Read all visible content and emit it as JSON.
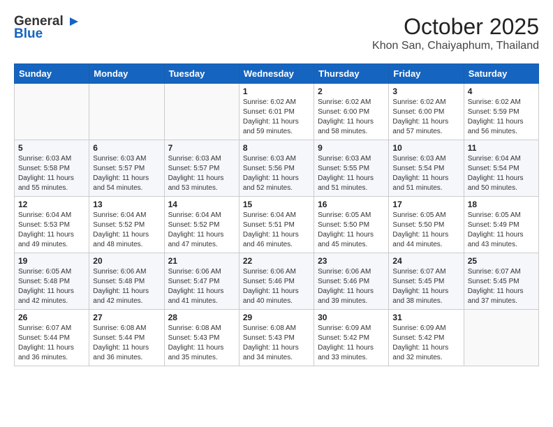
{
  "header": {
    "logo_general": "General",
    "logo_blue": "Blue",
    "title": "October 2025",
    "subtitle": "Khon San, Chaiyaphum, Thailand"
  },
  "days_of_week": [
    "Sunday",
    "Monday",
    "Tuesday",
    "Wednesday",
    "Thursday",
    "Friday",
    "Saturday"
  ],
  "weeks": [
    [
      {
        "day": "",
        "sunrise": "",
        "sunset": "",
        "daylight": ""
      },
      {
        "day": "",
        "sunrise": "",
        "sunset": "",
        "daylight": ""
      },
      {
        "day": "",
        "sunrise": "",
        "sunset": "",
        "daylight": ""
      },
      {
        "day": "1",
        "sunrise": "Sunrise: 6:02 AM",
        "sunset": "Sunset: 6:01 PM",
        "daylight": "Daylight: 11 hours and 59 minutes."
      },
      {
        "day": "2",
        "sunrise": "Sunrise: 6:02 AM",
        "sunset": "Sunset: 6:00 PM",
        "daylight": "Daylight: 11 hours and 58 minutes."
      },
      {
        "day": "3",
        "sunrise": "Sunrise: 6:02 AM",
        "sunset": "Sunset: 6:00 PM",
        "daylight": "Daylight: 11 hours and 57 minutes."
      },
      {
        "day": "4",
        "sunrise": "Sunrise: 6:02 AM",
        "sunset": "Sunset: 5:59 PM",
        "daylight": "Daylight: 11 hours and 56 minutes."
      }
    ],
    [
      {
        "day": "5",
        "sunrise": "Sunrise: 6:03 AM",
        "sunset": "Sunset: 5:58 PM",
        "daylight": "Daylight: 11 hours and 55 minutes."
      },
      {
        "day": "6",
        "sunrise": "Sunrise: 6:03 AM",
        "sunset": "Sunset: 5:57 PM",
        "daylight": "Daylight: 11 hours and 54 minutes."
      },
      {
        "day": "7",
        "sunrise": "Sunrise: 6:03 AM",
        "sunset": "Sunset: 5:57 PM",
        "daylight": "Daylight: 11 hours and 53 minutes."
      },
      {
        "day": "8",
        "sunrise": "Sunrise: 6:03 AM",
        "sunset": "Sunset: 5:56 PM",
        "daylight": "Daylight: 11 hours and 52 minutes."
      },
      {
        "day": "9",
        "sunrise": "Sunrise: 6:03 AM",
        "sunset": "Sunset: 5:55 PM",
        "daylight": "Daylight: 11 hours and 51 minutes."
      },
      {
        "day": "10",
        "sunrise": "Sunrise: 6:03 AM",
        "sunset": "Sunset: 5:54 PM",
        "daylight": "Daylight: 11 hours and 51 minutes."
      },
      {
        "day": "11",
        "sunrise": "Sunrise: 6:04 AM",
        "sunset": "Sunset: 5:54 PM",
        "daylight": "Daylight: 11 hours and 50 minutes."
      }
    ],
    [
      {
        "day": "12",
        "sunrise": "Sunrise: 6:04 AM",
        "sunset": "Sunset: 5:53 PM",
        "daylight": "Daylight: 11 hours and 49 minutes."
      },
      {
        "day": "13",
        "sunrise": "Sunrise: 6:04 AM",
        "sunset": "Sunset: 5:52 PM",
        "daylight": "Daylight: 11 hours and 48 minutes."
      },
      {
        "day": "14",
        "sunrise": "Sunrise: 6:04 AM",
        "sunset": "Sunset: 5:52 PM",
        "daylight": "Daylight: 11 hours and 47 minutes."
      },
      {
        "day": "15",
        "sunrise": "Sunrise: 6:04 AM",
        "sunset": "Sunset: 5:51 PM",
        "daylight": "Daylight: 11 hours and 46 minutes."
      },
      {
        "day": "16",
        "sunrise": "Sunrise: 6:05 AM",
        "sunset": "Sunset: 5:50 PM",
        "daylight": "Daylight: 11 hours and 45 minutes."
      },
      {
        "day": "17",
        "sunrise": "Sunrise: 6:05 AM",
        "sunset": "Sunset: 5:50 PM",
        "daylight": "Daylight: 11 hours and 44 minutes."
      },
      {
        "day": "18",
        "sunrise": "Sunrise: 6:05 AM",
        "sunset": "Sunset: 5:49 PM",
        "daylight": "Daylight: 11 hours and 43 minutes."
      }
    ],
    [
      {
        "day": "19",
        "sunrise": "Sunrise: 6:05 AM",
        "sunset": "Sunset: 5:48 PM",
        "daylight": "Daylight: 11 hours and 42 minutes."
      },
      {
        "day": "20",
        "sunrise": "Sunrise: 6:06 AM",
        "sunset": "Sunset: 5:48 PM",
        "daylight": "Daylight: 11 hours and 42 minutes."
      },
      {
        "day": "21",
        "sunrise": "Sunrise: 6:06 AM",
        "sunset": "Sunset: 5:47 PM",
        "daylight": "Daylight: 11 hours and 41 minutes."
      },
      {
        "day": "22",
        "sunrise": "Sunrise: 6:06 AM",
        "sunset": "Sunset: 5:46 PM",
        "daylight": "Daylight: 11 hours and 40 minutes."
      },
      {
        "day": "23",
        "sunrise": "Sunrise: 6:06 AM",
        "sunset": "Sunset: 5:46 PM",
        "daylight": "Daylight: 11 hours and 39 minutes."
      },
      {
        "day": "24",
        "sunrise": "Sunrise: 6:07 AM",
        "sunset": "Sunset: 5:45 PM",
        "daylight": "Daylight: 11 hours and 38 minutes."
      },
      {
        "day": "25",
        "sunrise": "Sunrise: 6:07 AM",
        "sunset": "Sunset: 5:45 PM",
        "daylight": "Daylight: 11 hours and 37 minutes."
      }
    ],
    [
      {
        "day": "26",
        "sunrise": "Sunrise: 6:07 AM",
        "sunset": "Sunset: 5:44 PM",
        "daylight": "Daylight: 11 hours and 36 minutes."
      },
      {
        "day": "27",
        "sunrise": "Sunrise: 6:08 AM",
        "sunset": "Sunset: 5:44 PM",
        "daylight": "Daylight: 11 hours and 36 minutes."
      },
      {
        "day": "28",
        "sunrise": "Sunrise: 6:08 AM",
        "sunset": "Sunset: 5:43 PM",
        "daylight": "Daylight: 11 hours and 35 minutes."
      },
      {
        "day": "29",
        "sunrise": "Sunrise: 6:08 AM",
        "sunset": "Sunset: 5:43 PM",
        "daylight": "Daylight: 11 hours and 34 minutes."
      },
      {
        "day": "30",
        "sunrise": "Sunrise: 6:09 AM",
        "sunset": "Sunset: 5:42 PM",
        "daylight": "Daylight: 11 hours and 33 minutes."
      },
      {
        "day": "31",
        "sunrise": "Sunrise: 6:09 AM",
        "sunset": "Sunset: 5:42 PM",
        "daylight": "Daylight: 11 hours and 32 minutes."
      },
      {
        "day": "",
        "sunrise": "",
        "sunset": "",
        "daylight": ""
      }
    ]
  ]
}
